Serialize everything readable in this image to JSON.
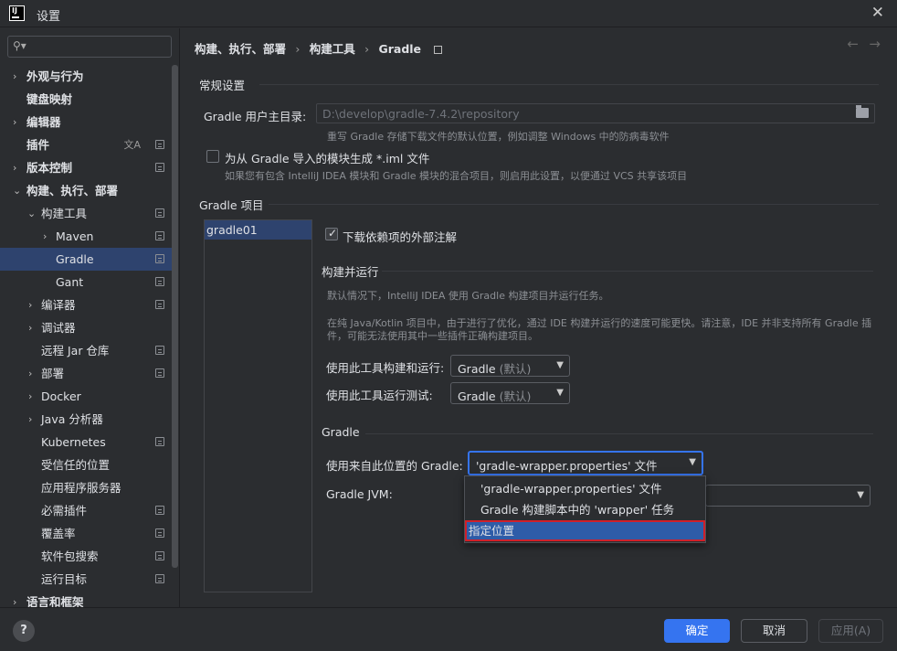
{
  "window": {
    "title": "设置"
  },
  "search": {
    "placeholder": ""
  },
  "sidebar": {
    "items": [
      {
        "label": "外观与行为"
      },
      {
        "label": "键盘映射"
      },
      {
        "label": "编辑器"
      },
      {
        "label": "插件"
      },
      {
        "label": "版本控制"
      },
      {
        "label": "构建、执行、部署"
      },
      {
        "label": "构建工具"
      },
      {
        "label": "Maven"
      },
      {
        "label": "Gradle"
      },
      {
        "label": "Gant"
      },
      {
        "label": "编译器"
      },
      {
        "label": "调试器"
      },
      {
        "label": "远程 Jar 仓库"
      },
      {
        "label": "部署"
      },
      {
        "label": "Docker"
      },
      {
        "label": "Java 分析器"
      },
      {
        "label": "Kubernetes"
      },
      {
        "label": "受信任的位置"
      },
      {
        "label": "应用程序服务器"
      },
      {
        "label": "必需插件"
      },
      {
        "label": "覆盖率"
      },
      {
        "label": "软件包搜索"
      },
      {
        "label": "运行目标"
      },
      {
        "label": "语言和框架"
      }
    ]
  },
  "breadcrumb": {
    "part1": "构建、执行、部署",
    "sep": "›",
    "part2": "构建工具",
    "part3": "Gradle"
  },
  "nav": {
    "back": "←",
    "forward": "→"
  },
  "general": {
    "title": "常规设置",
    "home_label": "Gradle 用户主目录:",
    "home_value": "D:\\develop\\gradle-7.4.2\\repository",
    "home_hint": "重写 Gradle 存储下载文件的默认位置，例如调整 Windows 中的防病毒软件",
    "iml_label": "为从 Gradle 导入的模块生成 *.iml 文件",
    "iml_hint": "如果您有包含 IntelliJ IDEA 模块和 Gradle 模块的混合项目，则启用此设置，以便通过 VCS 共享该项目"
  },
  "projects": {
    "title": "Gradle 项目",
    "items": [
      "gradle01"
    ]
  },
  "download": {
    "label": "下载依赖项的外部注解"
  },
  "build_run": {
    "title": "构建并运行",
    "hint1": "默认情况下，IntelliJ IDEA 使用 Gradle 构建项目并运行任务。",
    "hint2": "在纯 Java/Kotlin 项目中，由于进行了优化，通过 IDE 构建并运行的速度可能更快。请注意，IDE 并非支持所有 Gradle 插",
    "hint3": "件，可能无法使用其中一些插件正确构建项目。",
    "build_label": "使用此工具构建和运行:",
    "build_value": "Gradle",
    "build_default": "(默认)",
    "test_label": "使用此工具运行测试:",
    "test_value": "Gradle",
    "test_default": "(默认)"
  },
  "gradle": {
    "title": "Gradle",
    "from_label": "使用来自此位置的 Gradle:",
    "from_value": "'gradle-wrapper.properties' 文件",
    "jvm_label": "Gradle JVM:",
    "options": [
      "'gradle-wrapper.properties' 文件",
      "Gradle 构建脚本中的 'wrapper' 任务",
      "指定位置"
    ]
  },
  "footer": {
    "help": "?",
    "ok": "确定",
    "cancel": "取消",
    "apply": "应用(A)"
  }
}
